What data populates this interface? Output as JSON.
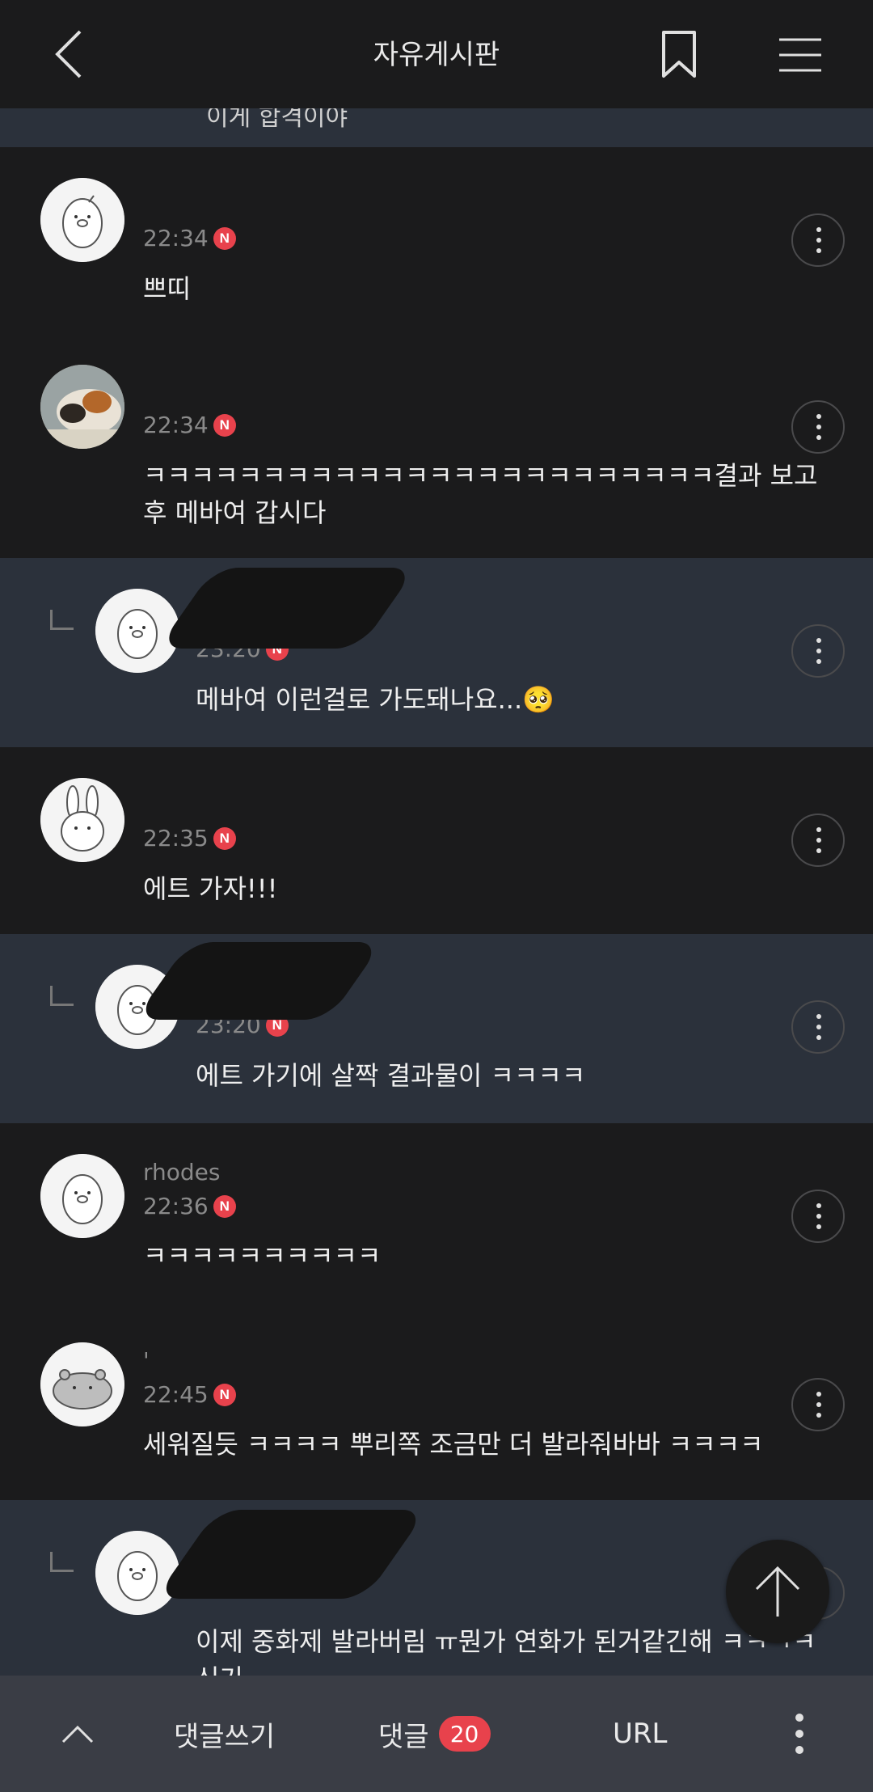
{
  "header": {
    "title": "자유게시판"
  },
  "partial_comment": {
    "text": "이게 합격이야"
  },
  "comments": [
    {
      "username": "",
      "time": "22:34",
      "badge": "N",
      "text": "쁘띠"
    },
    {
      "username": "",
      "time": "22:34",
      "badge": "N",
      "text": "ㅋㅋㅋㅋㅋㅋㅋㅋㅋㅋㅋㅋㅋㅋㅋㅋㅋㅋㅋㅋㅋㅋㅋㅋ결과 보고 후 메바여 갑시다"
    },
    {
      "username": "",
      "time": "23:20",
      "badge": "N",
      "text": "메바여 이런걸로 가도돼나요...🥺",
      "reply": true
    },
    {
      "username": "",
      "time": "22:35",
      "badge": "N",
      "text": "에트 가자!!!"
    },
    {
      "username": "",
      "time": "23:20",
      "badge": "N",
      "text": "에트 가기에 살짝 결과물이 ㅋㅋㅋㅋ",
      "reply": true
    },
    {
      "username": "rhodes",
      "time": "22:36",
      "badge": "N",
      "text": "ㅋㅋㅋㅋㅋㅋㅋㅋㅋㅋ"
    },
    {
      "username": "'",
      "time": "22:45",
      "badge": "N",
      "text": "세워질듯 ㅋㅋㅋㅋ 뿌리쪽 조금만 더 발라줘바바 ㅋㅋㅋㅋ"
    },
    {
      "username": "",
      "time": "",
      "badge": "",
      "text": "이제 중화제 발라버림 ㅠ뭔가 연화가 된거같긴해 ㅋㅋㅋㅋ 신기",
      "reply": true
    }
  ],
  "bottom_bar": {
    "write_label": "댓글쓰기",
    "comments_label": "댓글",
    "comments_count": "20",
    "url_label": "URL"
  },
  "colors": {
    "background": "#1b1b1c",
    "reply_background": "#2b313b",
    "accent": "#e8424c",
    "bottom_bar": "#3a3d45"
  }
}
